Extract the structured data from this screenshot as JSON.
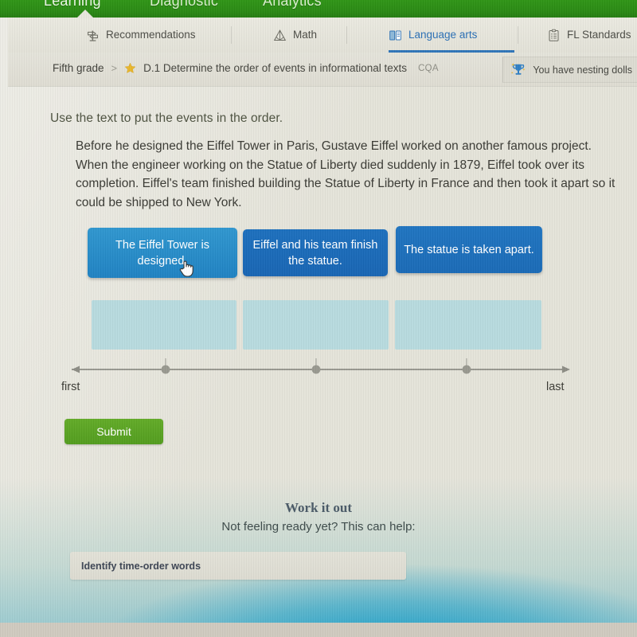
{
  "app_bar": {
    "tabs": [
      {
        "label": "Learning",
        "active": true
      },
      {
        "label": "Diagnostic",
        "active": false
      },
      {
        "label": "Analytics",
        "active": false
      }
    ]
  },
  "subject_tabs": [
    {
      "label": "Recommendations",
      "icon": "signpost-icon",
      "active": false
    },
    {
      "label": "Math",
      "icon": "pyramid-icon",
      "active": false
    },
    {
      "label": "Language arts",
      "icon": "open-book-icon",
      "active": true
    },
    {
      "label": "FL Standards",
      "icon": "clipboard-icon",
      "active": false
    }
  ],
  "breadcrumb": {
    "grade": "Fifth grade",
    "separator": ">",
    "skill_icon": "star-icon",
    "skill": "D.1 Determine the order of events in informational texts",
    "code": "CQA"
  },
  "award": {
    "icon": "trophy-icon",
    "label": "You have nesting dolls"
  },
  "question": {
    "prompt": "Use the text to put the events in the order.",
    "passage": "Before he designed the Eiffel Tower in Paris, Gustave Eiffel worked on another famous project. When the engineer working on the Statue of Liberty died suddenly in 1879, Eiffel took over its completion. Eiffel's team finished building the Statue of Liberty in France and then took it apart so it could be shipped to New York."
  },
  "cards": [
    {
      "label": "The Eiffel Tower is designed.",
      "state": "hovered",
      "color": "#2388c7"
    },
    {
      "label": "Eiffel and his team finish the statue.",
      "state": "default",
      "color": "#1a6ab6"
    },
    {
      "label": "The statue is taken apart.",
      "state": "default",
      "color": "#1c70bb"
    }
  ],
  "dropzones": [
    {
      "label": "",
      "filled": false
    },
    {
      "label": "",
      "filled": false
    },
    {
      "label": "",
      "filled": false
    }
  ],
  "timeline": {
    "start_label": "first",
    "end_label": "last",
    "point_count": 3
  },
  "actions": {
    "submit_label": "Submit"
  },
  "work_it_out": {
    "heading": "Work it out",
    "subheading": "Not feeling ready yet? This can help:",
    "link_label": "Identify time-order words"
  },
  "colors": {
    "app_bar_green": "#2a8a14",
    "active_tab_blue": "#2f74b8",
    "card_blue": "#1a6ab6",
    "card_blue_hover": "#2388c7",
    "dropzone_teal": "#b7dade",
    "submit_green": "#549e20",
    "page_background": "#e4e3d9"
  }
}
